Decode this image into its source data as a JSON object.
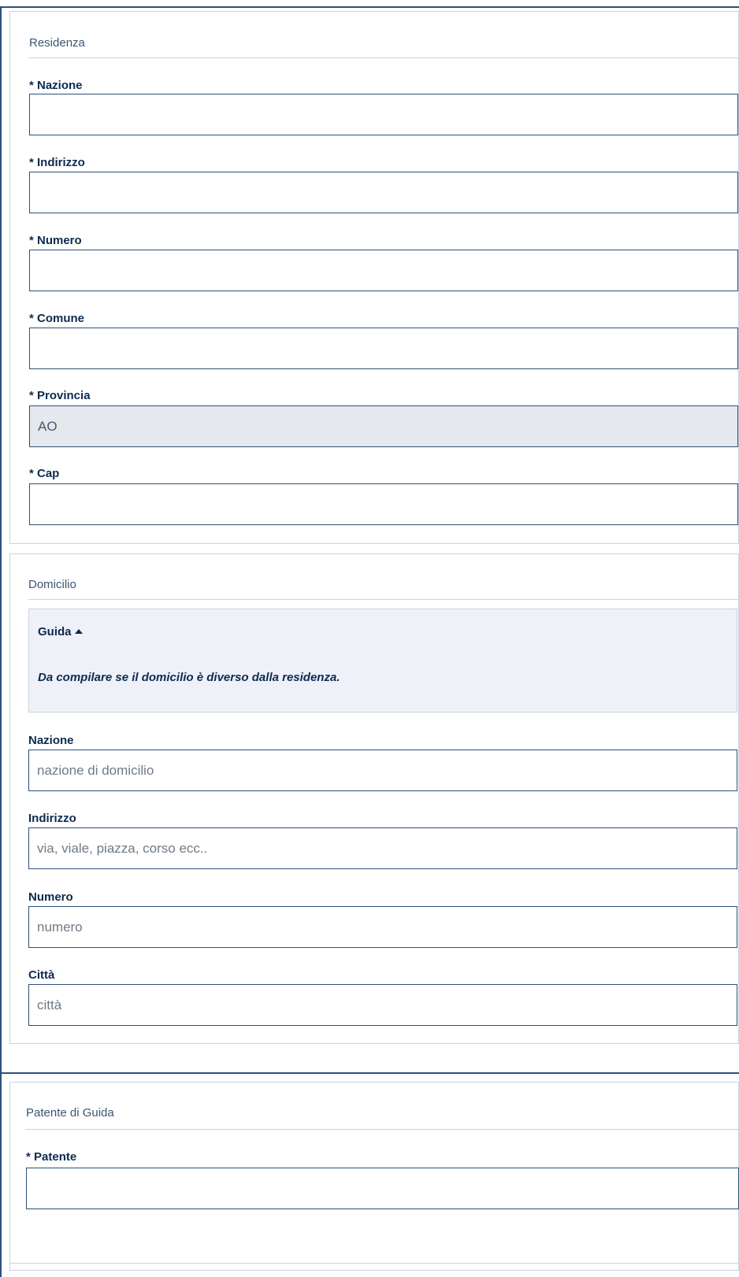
{
  "residenza": {
    "legend": "Residenza",
    "fields": [
      {
        "label": "* Nazione",
        "value": ""
      },
      {
        "label": "* Indirizzo",
        "value": ""
      },
      {
        "label": "* Numero",
        "value": ""
      },
      {
        "label": "* Comune",
        "value": ""
      },
      {
        "label": "* Provincia",
        "value": "AO"
      },
      {
        "label": "* Cap",
        "value": ""
      }
    ]
  },
  "domicilio": {
    "legend": "Domicilio",
    "guide": {
      "title": "Guida",
      "text": "Da compilare se il domicilio è diverso dalla residenza."
    },
    "fields": [
      {
        "label": "Nazione",
        "placeholder": "nazione di domicilio"
      },
      {
        "label": "Indirizzo",
        "placeholder": "via, viale, piazza, corso ecc.."
      },
      {
        "label": "Numero",
        "placeholder": "numero"
      },
      {
        "label": "Città",
        "placeholder": "città"
      }
    ]
  },
  "patente": {
    "legend": "Patente di Guida",
    "fields": [
      {
        "label": "* Patente",
        "value": ""
      }
    ]
  },
  "icons": {
    "guide_toggle": "caret-up-icon"
  },
  "colors": {
    "border_dark": "#2e4f7a",
    "border_light": "#c9d3df",
    "guide_bg": "#eef2f8",
    "disabled_bg": "#e5e8ec"
  }
}
